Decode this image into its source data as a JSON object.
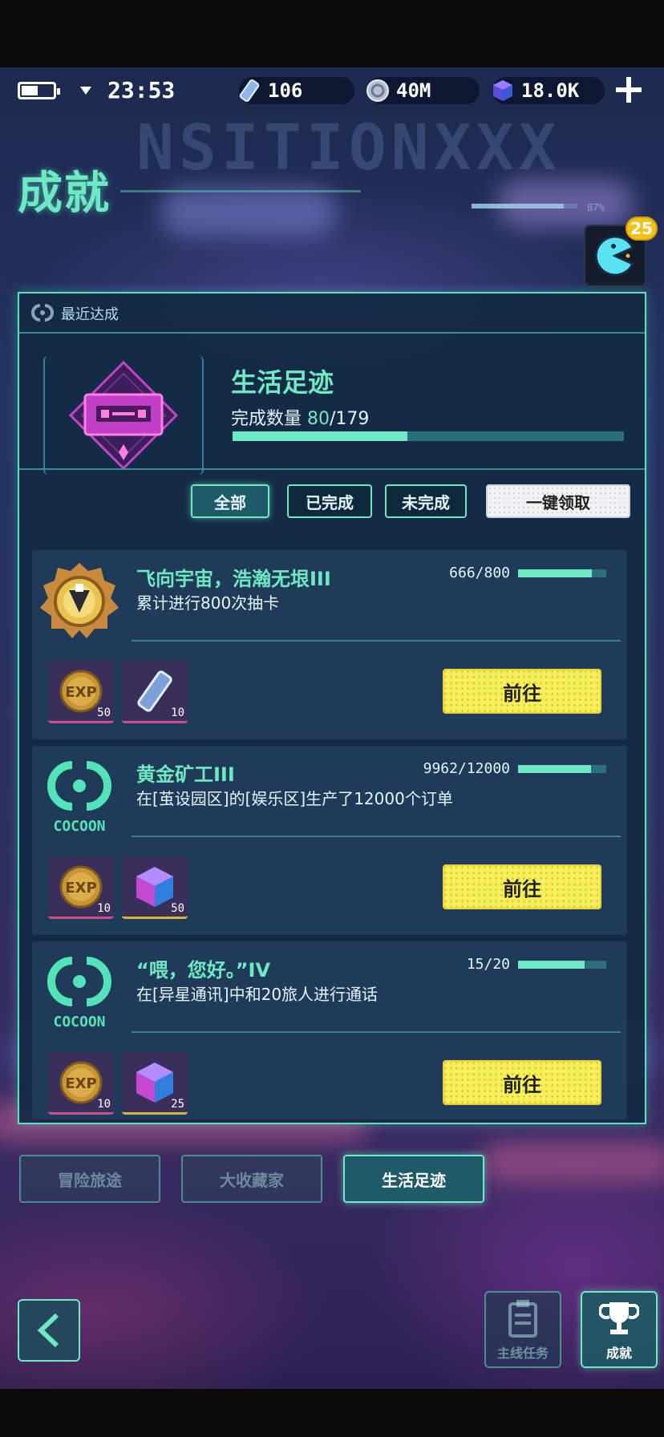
{
  "status": {
    "time": "23:53",
    "resources": [
      {
        "icon": "ticket-icon",
        "value": "106"
      },
      {
        "icon": "coin-icon",
        "value": "40M"
      },
      {
        "icon": "gem-cube-icon",
        "value": "18.0K"
      }
    ]
  },
  "header": {
    "title": "成就",
    "badge_count": "25",
    "mini_progress_percent": "87%",
    "mini_progress_fraction": 0.87
  },
  "recent": {
    "section_label": "最近达成",
    "name": "生活足迹",
    "count_label": "完成数量",
    "count_done": "80",
    "count_total": "/179",
    "progress_fraction": 0.447
  },
  "filters": {
    "all": "全部",
    "completed": "已完成",
    "uncompleted": "未完成",
    "claim_all": "一键领取"
  },
  "achievements": [
    {
      "name": "飞向宇宙，浩瀚无垠III",
      "desc": "累计进行800次抽卡",
      "progress_text": "666/800",
      "progress_fraction": 0.8325,
      "rewards": [
        {
          "icon": "exp-coin-icon",
          "count": "50"
        },
        {
          "icon": "ticket-icon",
          "count": "10"
        }
      ],
      "go_label": "前往"
    },
    {
      "name": "黄金矿工III",
      "desc": "在[茧设园区]的[娱乐区]生产了12000个订单",
      "progress_text": "9962/12000",
      "progress_fraction": 0.83,
      "brand": "COCOON",
      "rewards": [
        {
          "icon": "exp-coin-icon",
          "count": "10"
        },
        {
          "icon": "gem-cube-icon",
          "count": "50"
        }
      ],
      "go_label": "前往"
    },
    {
      "name": "“喂，您好。”IV",
      "desc": "在[异星通讯]中和20旅人进行通话",
      "progress_text": "15/20",
      "progress_fraction": 0.75,
      "brand": "COCOON",
      "rewards": [
        {
          "icon": "exp-coin-icon",
          "count": "10"
        },
        {
          "icon": "gem-cube-icon",
          "count": "25"
        }
      ],
      "go_label": "前往"
    }
  ],
  "categories": [
    "冒险旅途",
    "大收藏家",
    "生活足迹"
  ],
  "nav": {
    "main_tasks": "主线任务",
    "achievements": "成就"
  },
  "colors": {
    "accent": "#6fe8c4",
    "go_button": "#f5f05a",
    "panel": "#142a42"
  }
}
